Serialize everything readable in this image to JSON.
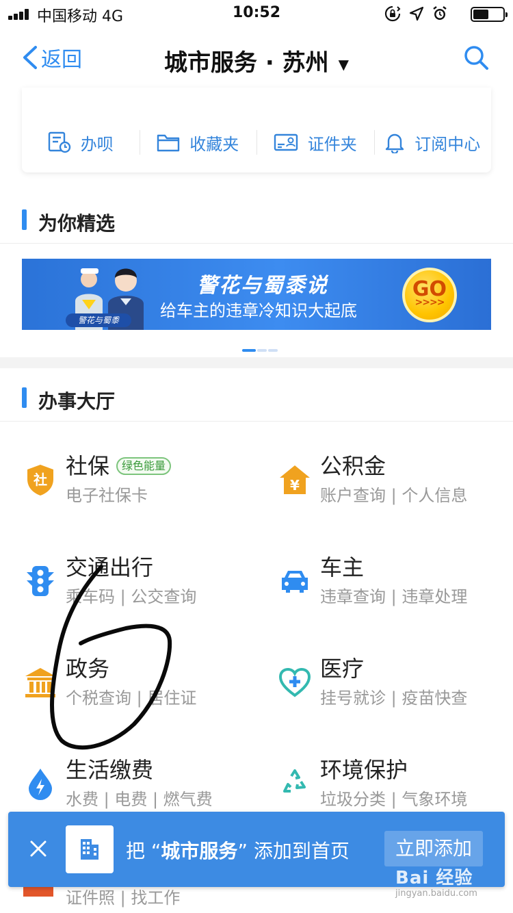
{
  "status_bar": {
    "carrier": "中国移动   4G",
    "time": "10:52"
  },
  "nav": {
    "back_label": "返回",
    "title": "城市服务 · 苏州",
    "title_caret": "▼"
  },
  "quick_actions": [
    {
      "label": "办呗",
      "icon": "document-clock-icon"
    },
    {
      "label": "收藏夹",
      "icon": "folder-icon"
    },
    {
      "label": "证件夹",
      "icon": "id-card-icon"
    },
    {
      "label": "订阅中心",
      "icon": "bell-icon"
    }
  ],
  "featured": {
    "heading": "为你精选",
    "banner": {
      "tag": "警花与蜀黍",
      "title": "警花与蜀黍说",
      "subtitle": "给车主的违章冷知识大起底",
      "go_label": "GO",
      "go_arrows": ">>>>"
    }
  },
  "hall": {
    "heading": "办事大厅",
    "services": [
      {
        "name": "社保",
        "badge": "绿色能量",
        "sub": "电子社保卡",
        "icon": "shield-social-security-icon",
        "color": "#f0a21f"
      },
      {
        "name": "公积金",
        "badge": "",
        "sub": "账户查询 | 个人信息",
        "icon": "house-yuan-icon",
        "color": "#f0a21f"
      },
      {
        "name": "交通出行",
        "badge": "",
        "sub": "乘车码 | 公交查询",
        "icon": "traffic-light-icon",
        "color": "#2f8cf0"
      },
      {
        "name": "车主",
        "badge": "",
        "sub": "违章查询 | 违章处理",
        "icon": "car-icon",
        "color": "#2f8cf0"
      },
      {
        "name": "政务",
        "badge": "",
        "sub": "个税查询 | 居住证",
        "icon": "government-building-icon",
        "color": "#f0a21f"
      },
      {
        "name": "医疗",
        "badge": "",
        "sub": "挂号就诊 | 疫苗快查",
        "icon": "heart-medical-icon",
        "color": "#33b9b0"
      },
      {
        "name": "生活缴费",
        "badge": "",
        "sub": "水费 | 电费 | 燃气费",
        "icon": "water-drop-bolt-icon",
        "color": "#2f8cf0"
      },
      {
        "name": "环境保护",
        "badge": "",
        "sub": "垃圾分类 | 气象环境",
        "icon": "recycle-icon",
        "color": "#33b9b0"
      }
    ],
    "partial_row_sub": "证件照 | 找工作"
  },
  "add_to_home": {
    "text_prefix": "把 “",
    "text_app": "城市服务",
    "text_suffix": "” 添加到首页",
    "button": "立即添加"
  },
  "watermark": {
    "main": "Bai 经验",
    "url": "jingyan.baidu.com"
  },
  "colors": {
    "accent": "#2f8cf0",
    "orange": "#f0a21f",
    "teal": "#33b9b0",
    "add_bar": "#3d8be3"
  }
}
